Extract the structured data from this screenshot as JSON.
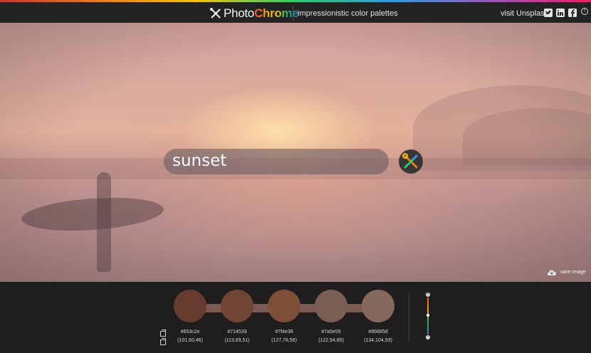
{
  "header": {
    "logo_photo": "Photo",
    "logo_chrome": "Chrome",
    "tagline": "impressionistic color palettes",
    "visit_link": "visit Unsplash",
    "social": [
      "twitter-icon",
      "linkedin-icon",
      "facebook-icon"
    ],
    "help_symbol": "?"
  },
  "search": {
    "value": "sunset"
  },
  "hero": {
    "save_label": "save image"
  },
  "palette": {
    "swatches": [
      {
        "hex": "#653c2e",
        "rgb": "(101,60,46)"
      },
      {
        "hex": "#714533",
        "rgb": "(113,69,51)"
      },
      {
        "hex": "#7f4e38",
        "rgb": "(127,78,56)"
      },
      {
        "hex": "#7a5e55",
        "rgb": "(122,94,85)"
      },
      {
        "hex": "#86685d",
        "rgb": "(134,104,93)"
      }
    ]
  },
  "colors": {
    "header_bg": "#232323",
    "bottom_bg": "#1f1d1d",
    "search_bg": "rgba(110,95,100,0.62)"
  },
  "slider": {
    "plus": "+",
    "minus": "−"
  }
}
